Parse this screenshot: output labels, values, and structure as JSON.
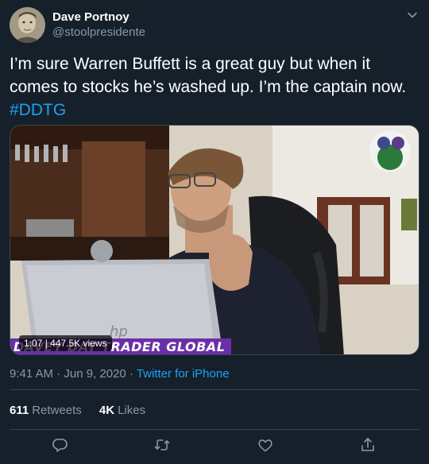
{
  "author": {
    "display_name": "Dave Portnoy",
    "handle": "@stoolpresidente"
  },
  "tweet": {
    "text": "I’m sure Warren Buffett is a great guy but when it comes to stocks he’s washed up. I’m the captain now.",
    "hashtag": "#DDTG"
  },
  "media": {
    "duration": "1:07",
    "views": "447.5K views",
    "banner": "DAVEY DAY TRADER GLOBAL"
  },
  "meta": {
    "time": "9:41 AM · Jun 9, 2020",
    "separator": " · ",
    "source": "Twitter for iPhone"
  },
  "stats": {
    "retweets_count": "611",
    "retweets_label": "Retweets",
    "likes_count": "4K",
    "likes_label": "Likes"
  },
  "colors": {
    "background": "#15202b",
    "accent": "#1da1f2",
    "secondary_text": "#8899a6",
    "divider": "#38444d",
    "banner": "#6a2fa8"
  },
  "icons": [
    "caret-down-icon",
    "reply-icon",
    "retweet-icon",
    "like-icon",
    "share-icon"
  ]
}
